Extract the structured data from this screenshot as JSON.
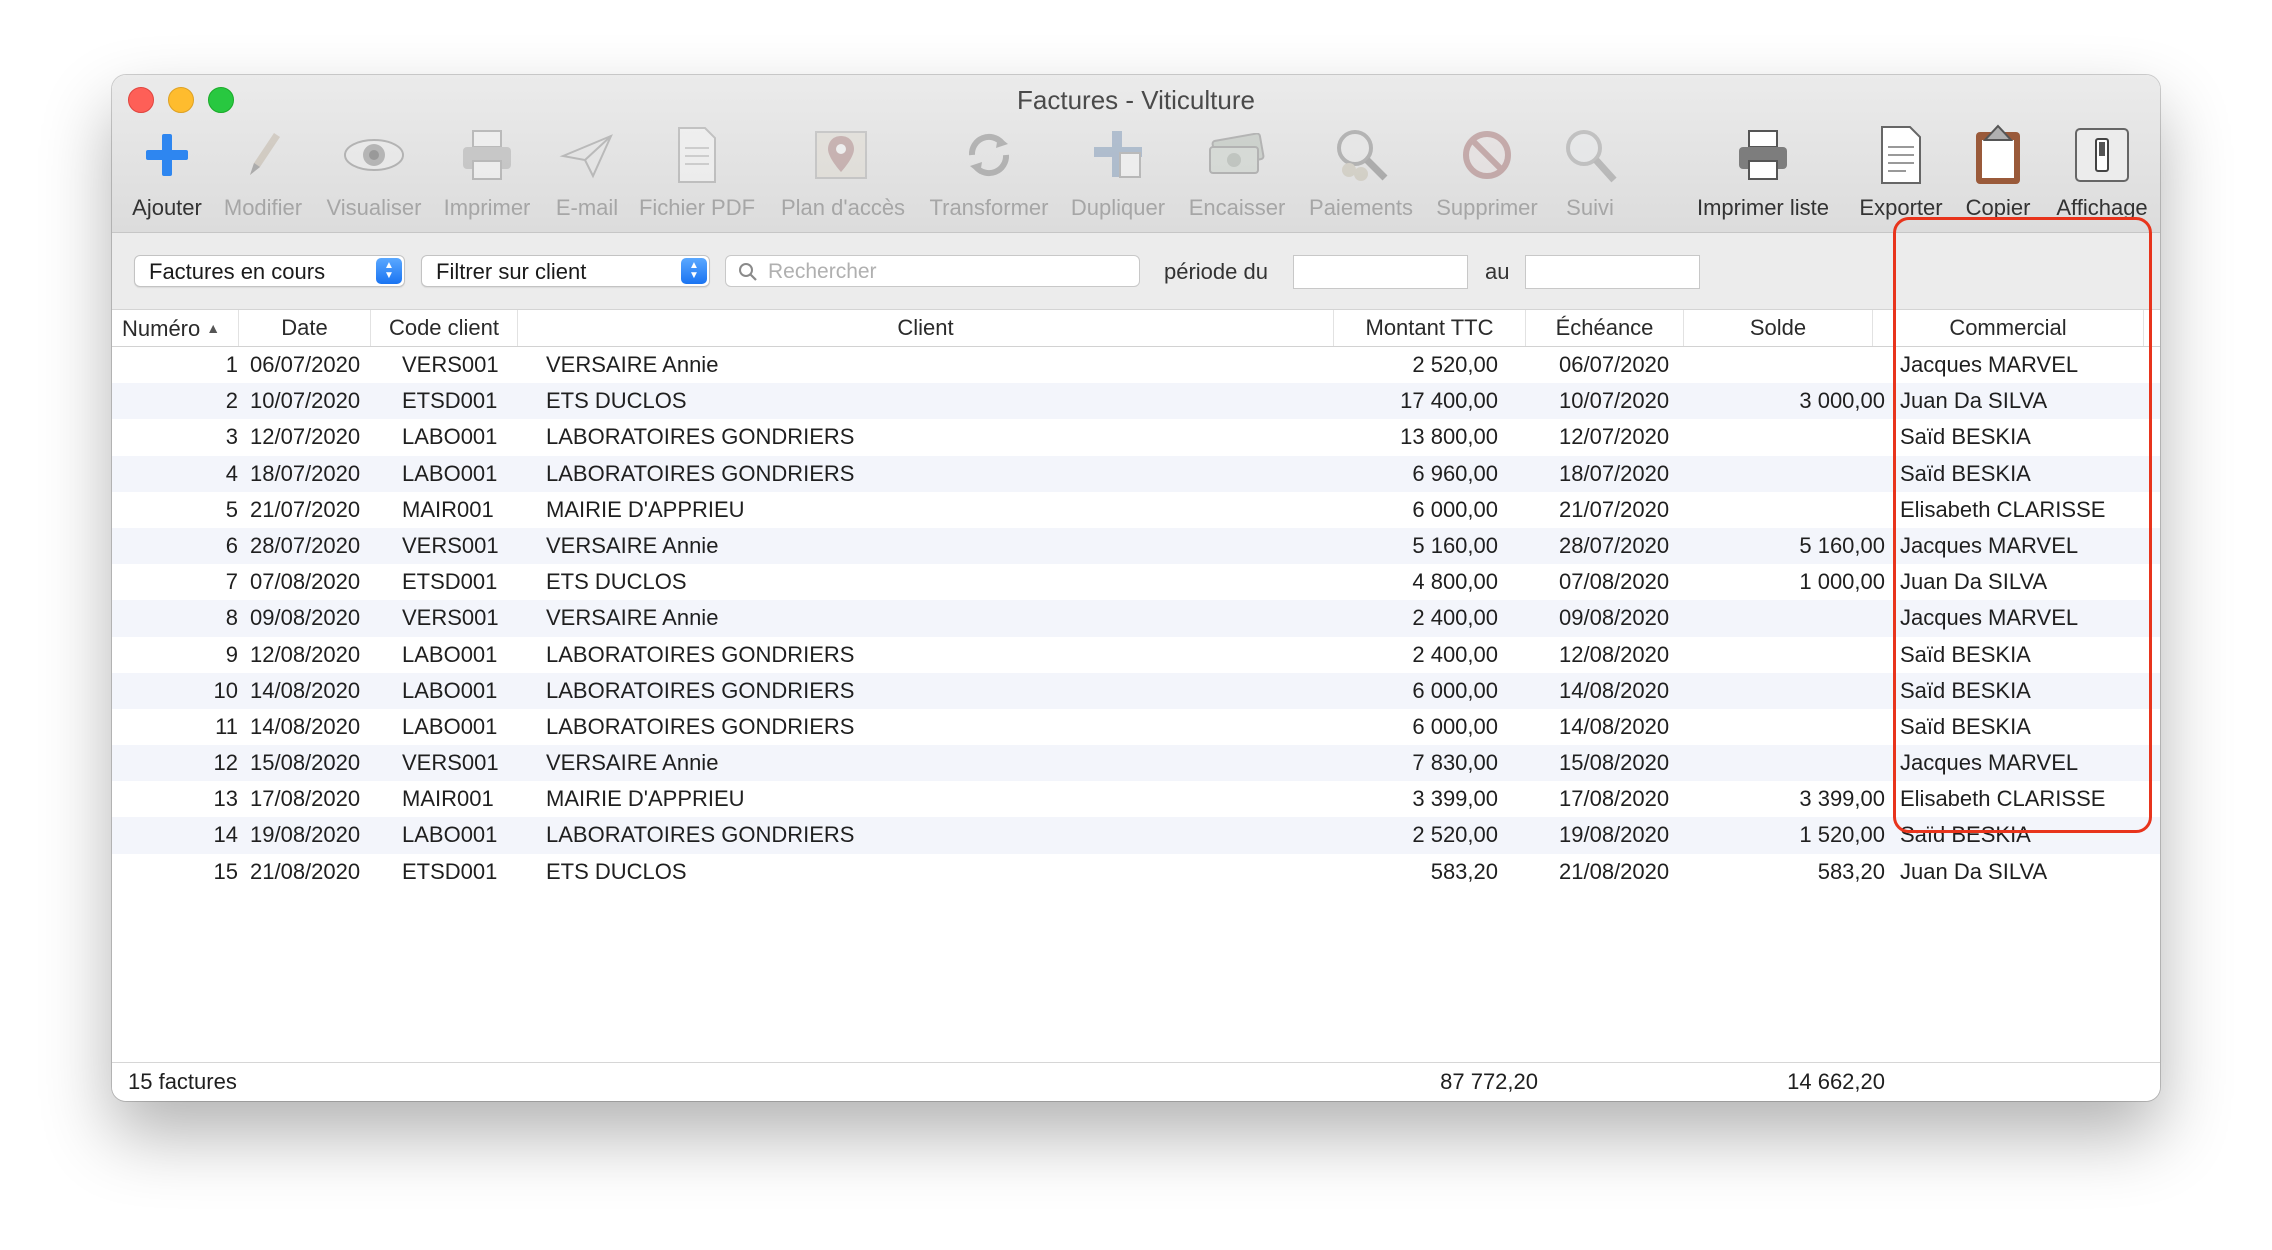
{
  "window": {
    "title": "Factures - Viticulture"
  },
  "toolbar": [
    {
      "label": "Ajouter",
      "icon": "plus-icon",
      "enabled": true
    },
    {
      "label": "Modifier",
      "icon": "pencil-icon",
      "enabled": false
    },
    {
      "label": "Visualiser",
      "icon": "eye-icon",
      "enabled": false
    },
    {
      "label": "Imprimer",
      "icon": "printer-icon",
      "enabled": false
    },
    {
      "label": "E-mail",
      "icon": "paper-plane-icon",
      "enabled": false
    },
    {
      "label": "Fichier PDF",
      "icon": "document-icon",
      "enabled": false
    },
    {
      "label": "Plan d'accès",
      "icon": "map-pin-icon",
      "enabled": false
    },
    {
      "label": "Transformer",
      "icon": "cycle-icon",
      "enabled": false
    },
    {
      "label": "Dupliquer",
      "icon": "duplicate-icon",
      "enabled": false
    },
    {
      "label": "Encaisser",
      "icon": "banknotes-icon",
      "enabled": false
    },
    {
      "label": "Paiements",
      "icon": "magnifier-coins-icon",
      "enabled": false
    },
    {
      "label": "Supprimer",
      "icon": "prohibited-icon",
      "enabled": false
    },
    {
      "label": "Suivi",
      "icon": "magnifier-icon",
      "enabled": false
    },
    {
      "label": "Imprimer liste",
      "icon": "printer-icon",
      "enabled": true
    },
    {
      "label": "Exporter",
      "icon": "export-document-icon",
      "enabled": true
    },
    {
      "label": "Copier",
      "icon": "clipboard-icon",
      "enabled": true
    },
    {
      "label": "Affichage",
      "icon": "display-toggle-icon",
      "enabled": true
    }
  ],
  "filters": {
    "status_select": "Factures en cours",
    "client_select": "Filtrer sur client",
    "search_placeholder": "Rechercher",
    "period_from_label": "période du",
    "period_to_label": "au"
  },
  "table": {
    "columns": [
      "Numéro",
      "Date",
      "Code client",
      "Client",
      "Montant TTC",
      "Échéance",
      "Solde",
      "Commercial"
    ],
    "rows": [
      [
        "1",
        "06/07/2020",
        "VERS001",
        "VERSAIRE Annie",
        "2 520,00",
        "06/07/2020",
        "",
        "Jacques MARVEL"
      ],
      [
        "2",
        "10/07/2020",
        "ETSD001",
        "ETS DUCLOS",
        "17 400,00",
        "10/07/2020",
        "3 000,00",
        "Juan Da SILVA"
      ],
      [
        "3",
        "12/07/2020",
        "LABO001",
        "LABORATOIRES GONDRIERS",
        "13 800,00",
        "12/07/2020",
        "",
        "Saïd BESKIA"
      ],
      [
        "4",
        "18/07/2020",
        "LABO001",
        "LABORATOIRES GONDRIERS",
        "6 960,00",
        "18/07/2020",
        "",
        "Saïd BESKIA"
      ],
      [
        "5",
        "21/07/2020",
        "MAIR001",
        "MAIRIE D'APPRIEU",
        "6 000,00",
        "21/07/2020",
        "",
        "Elisabeth CLARISSE"
      ],
      [
        "6",
        "28/07/2020",
        "VERS001",
        "VERSAIRE Annie",
        "5 160,00",
        "28/07/2020",
        "5 160,00",
        "Jacques MARVEL"
      ],
      [
        "7",
        "07/08/2020",
        "ETSD001",
        "ETS DUCLOS",
        "4 800,00",
        "07/08/2020",
        "1 000,00",
        "Juan Da SILVA"
      ],
      [
        "8",
        "09/08/2020",
        "VERS001",
        "VERSAIRE Annie",
        "2 400,00",
        "09/08/2020",
        "",
        "Jacques MARVEL"
      ],
      [
        "9",
        "12/08/2020",
        "LABO001",
        "LABORATOIRES GONDRIERS",
        "2 400,00",
        "12/08/2020",
        "",
        "Saïd BESKIA"
      ],
      [
        "10",
        "14/08/2020",
        "LABO001",
        "LABORATOIRES GONDRIERS",
        "6 000,00",
        "14/08/2020",
        "",
        "Saïd BESKIA"
      ],
      [
        "11",
        "14/08/2020",
        "LABO001",
        "LABORATOIRES GONDRIERS",
        "6 000,00",
        "14/08/2020",
        "",
        "Saïd BESKIA"
      ],
      [
        "12",
        "15/08/2020",
        "VERS001",
        "VERSAIRE Annie",
        "7 830,00",
        "15/08/2020",
        "",
        "Jacques MARVEL"
      ],
      [
        "13",
        "17/08/2020",
        "MAIR001",
        "MAIRIE D'APPRIEU",
        "3 399,00",
        "17/08/2020",
        "3 399,00",
        "Elisabeth CLARISSE"
      ],
      [
        "14",
        "19/08/2020",
        "LABO001",
        "LABORATOIRES GONDRIERS",
        "2 520,00",
        "19/08/2020",
        "1 520,00",
        "Saïd BESKIA"
      ],
      [
        "15",
        "21/08/2020",
        "ETSD001",
        "ETS DUCLOS",
        "583,20",
        "21/08/2020",
        "583,20",
        "Juan Da SILVA"
      ]
    ]
  },
  "footer": {
    "count": "15 factures",
    "total_ttc": "87 772,20",
    "total_solde": "14 662,20"
  },
  "colors": {
    "highlight": "#e8341c",
    "accent": "#1a74f2",
    "row_alt": "#f3f5fb"
  }
}
